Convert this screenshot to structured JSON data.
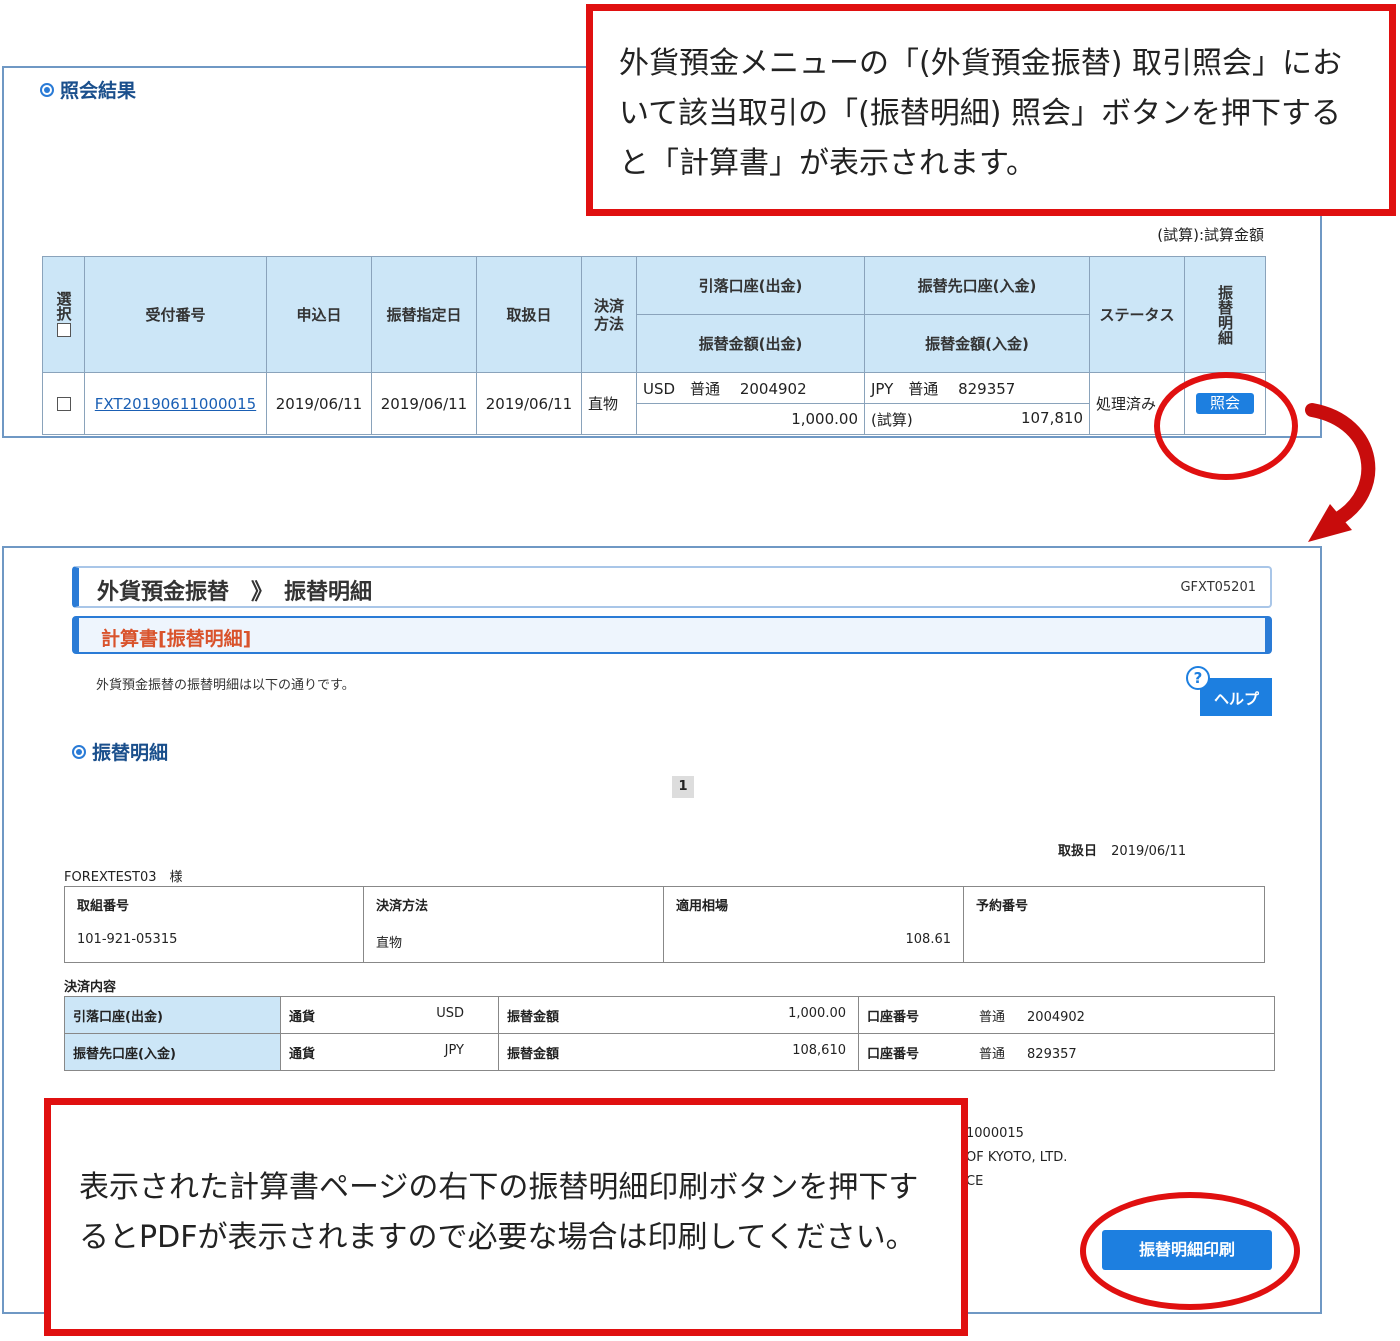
{
  "callouts": {
    "top": "外貨預金メニューの「(外貨預金振替) 取引照会」において該当取引の「(振替明細) 照会」ボタンを押下すると「計算書」が表示されます。",
    "bottom": "表示された計算書ページの右下の振替明細印刷ボタンを押下するとPDFが表示されますので必要な場合は印刷してください。"
  },
  "result": {
    "section_title": "照会結果",
    "note": "(試算):試算金額",
    "headers": {
      "select": "選択",
      "receipt_no": "受付番号",
      "apply_date": "申込日",
      "transfer_date": "振替指定日",
      "handling_date": "取扱日",
      "settle_method": "決済方法",
      "debit_account": "引落口座(出金)",
      "credit_account": "振替先口座(入金)",
      "debit_amount": "振替金額(出金)",
      "credit_amount": "振替金額(入金)",
      "status": "ステータス",
      "detail": "振替明細"
    },
    "row": {
      "receipt_no": "FXT20190611000015",
      "apply_date": "2019/06/11",
      "transfer_date": "2019/06/11",
      "handling_date": "2019/06/11",
      "settle_method": "直物",
      "debit_account": "USD　普通　 2004902",
      "debit_amount": "1,000.00",
      "credit_account": "JPY　普通　 829357",
      "credit_amount_label": "(試算)",
      "credit_amount": "107,810",
      "status": "処理済み",
      "inquiry_button": "照会"
    }
  },
  "detail": {
    "title": "外貨預金振替　》　振替明細",
    "screen_id": "GFXT05201",
    "subtitle": "計算書[振替明細]",
    "description": "外貨預金振替の振替明細は以下の通りです。",
    "help_button": "ヘルプ",
    "help_icon": "?",
    "section_title": "振替明細",
    "page_number": "1",
    "handling_date_label": "取扱日",
    "handling_date": "2019/06/11",
    "customer": "FOREXTEST03　様",
    "info": {
      "trade_no_label": "取組番号",
      "trade_no": "101-921-05315",
      "settle_label": "決済方法",
      "settle": "直物",
      "rate_label": "適用相場",
      "rate": "108.61",
      "reserve_label": "予約番号",
      "reserve": ""
    },
    "settlement_label": "決済内容",
    "settlement": [
      {
        "account_type": "引落口座(出金)",
        "currency_label": "通貨",
        "currency": "USD",
        "amount_label": "振替金額",
        "amount": "1,000.00",
        "account_label": "口座番号",
        "account_kind": "普通",
        "account_no": "2004902"
      },
      {
        "account_type": "振替先口座(入金)",
        "currency_label": "通貨",
        "currency": "JPY",
        "amount_label": "振替金額",
        "amount": "108,610",
        "account_label": "口座番号",
        "account_kind": "普通",
        "account_no": "829357"
      }
    ],
    "footer_lines": [
      "1000015",
      "OF KYOTO, LTD.",
      "CE"
    ],
    "print_button": "振替明細印刷"
  },
  "colors": {
    "callout_red": "#e01010",
    "accent_blue": "#1d7fe0",
    "header_bg": "#cce6f7"
  }
}
